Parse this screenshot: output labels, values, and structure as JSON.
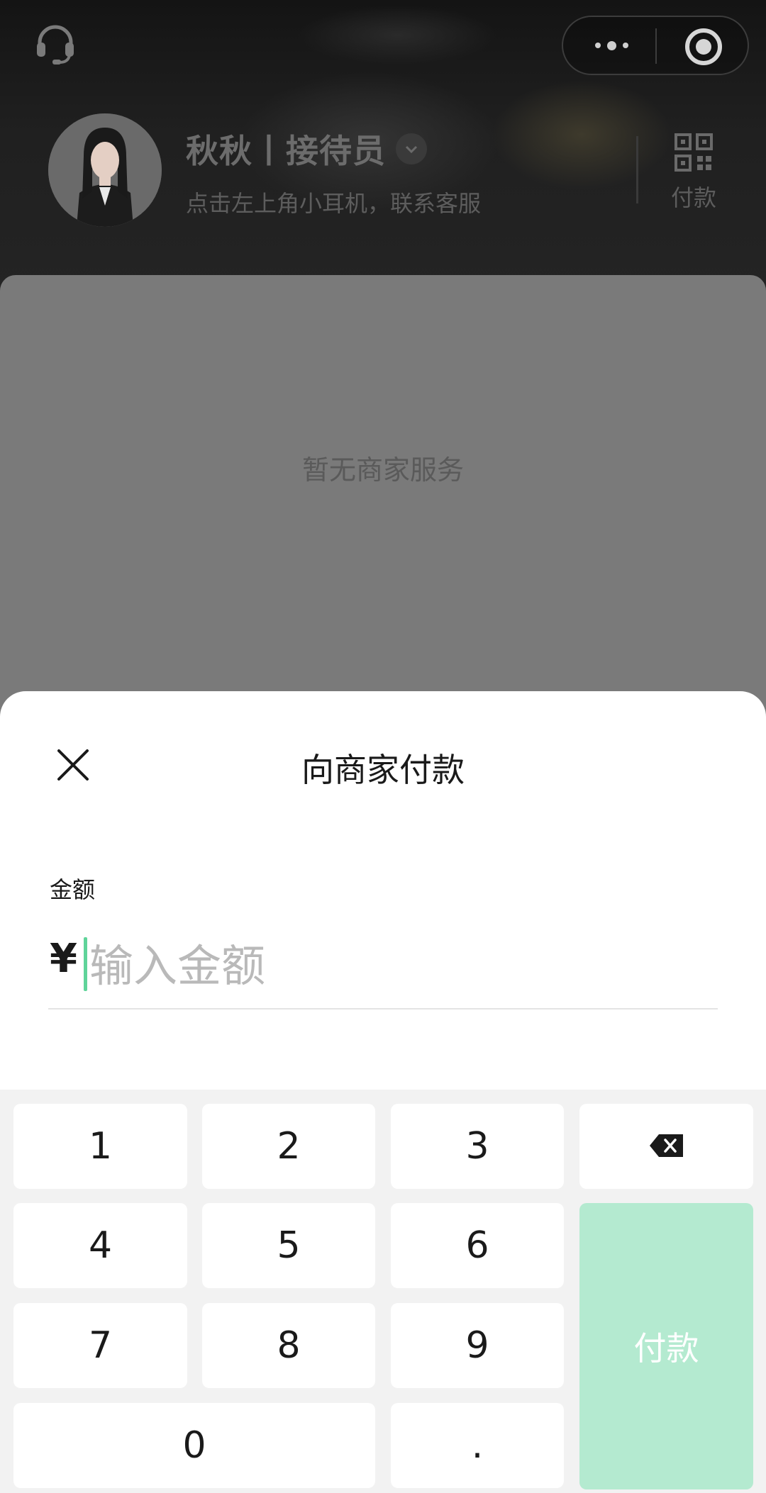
{
  "header": {
    "name": "秋秋丨接待员",
    "subtitle": "点击左上角小耳机，联系客服",
    "pay_label": "付款",
    "icons": [
      "headset-icon",
      "more-icon",
      "close-circle-icon",
      "chevron-down-icon",
      "qr-code-icon"
    ]
  },
  "content": {
    "empty_text": "暂无商家服务"
  },
  "sheet": {
    "title": "向商家付款",
    "amount_label": "金额",
    "currency_symbol": "¥",
    "amount_value": "",
    "amount_placeholder": "输入金额"
  },
  "keypad": {
    "keys": [
      "1",
      "2",
      "3",
      "4",
      "5",
      "6",
      "7",
      "8",
      "9",
      "0",
      "."
    ],
    "pay_label": "付款",
    "backspace_icon": "backspace-icon"
  },
  "colors": {
    "accent": "#5fd49a",
    "pay_button": "#b4ead0",
    "keypad_bg": "#f2f2f2"
  }
}
